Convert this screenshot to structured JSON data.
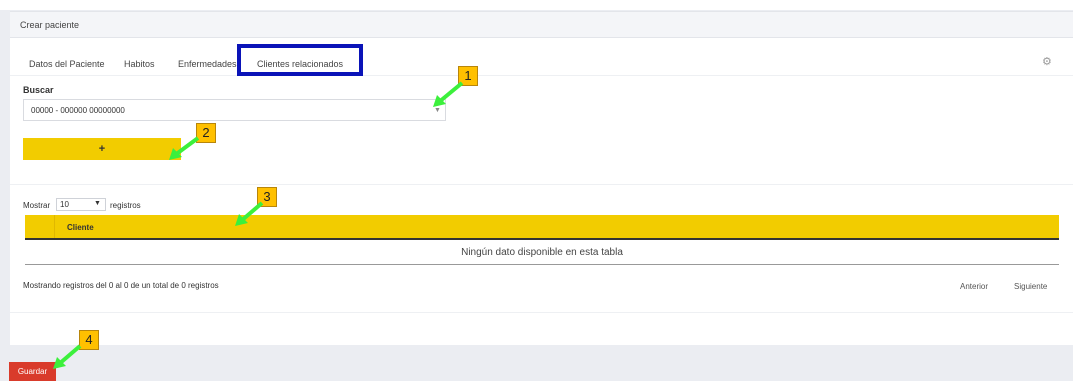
{
  "header": {
    "title": "Crear paciente"
  },
  "tabs": [
    {
      "label": "Datos del Paciente"
    },
    {
      "label": "Habitos"
    },
    {
      "label": "Enfermedades"
    },
    {
      "label": "Clientes relacionados"
    }
  ],
  "search": {
    "label": "Buscar",
    "selected_value": "00000 - 000000 00000000"
  },
  "add_button": {
    "label": "+"
  },
  "table_length": {
    "prefix": "Mostrar",
    "value": "10",
    "suffix": "registros"
  },
  "table": {
    "columns": [
      "",
      "Cliente"
    ],
    "empty_message": "Ningún dato disponible en esta tabla"
  },
  "table_info": "Mostrando registros del 0 al 0 de un total de 0 registros",
  "pagination": {
    "previous": "Anterior",
    "next": "Siguiente"
  },
  "save_button": {
    "label": "Guardar"
  },
  "annotations": [
    {
      "number": "1"
    },
    {
      "number": "2"
    },
    {
      "number": "3"
    },
    {
      "number": "4"
    }
  ],
  "colors": {
    "accent_yellow": "#f2cc00",
    "save_red": "#d93b2b",
    "highlight_blue": "#0a13b8",
    "arrow_green": "#3cf03c",
    "badge_orange": "#ffc000"
  }
}
